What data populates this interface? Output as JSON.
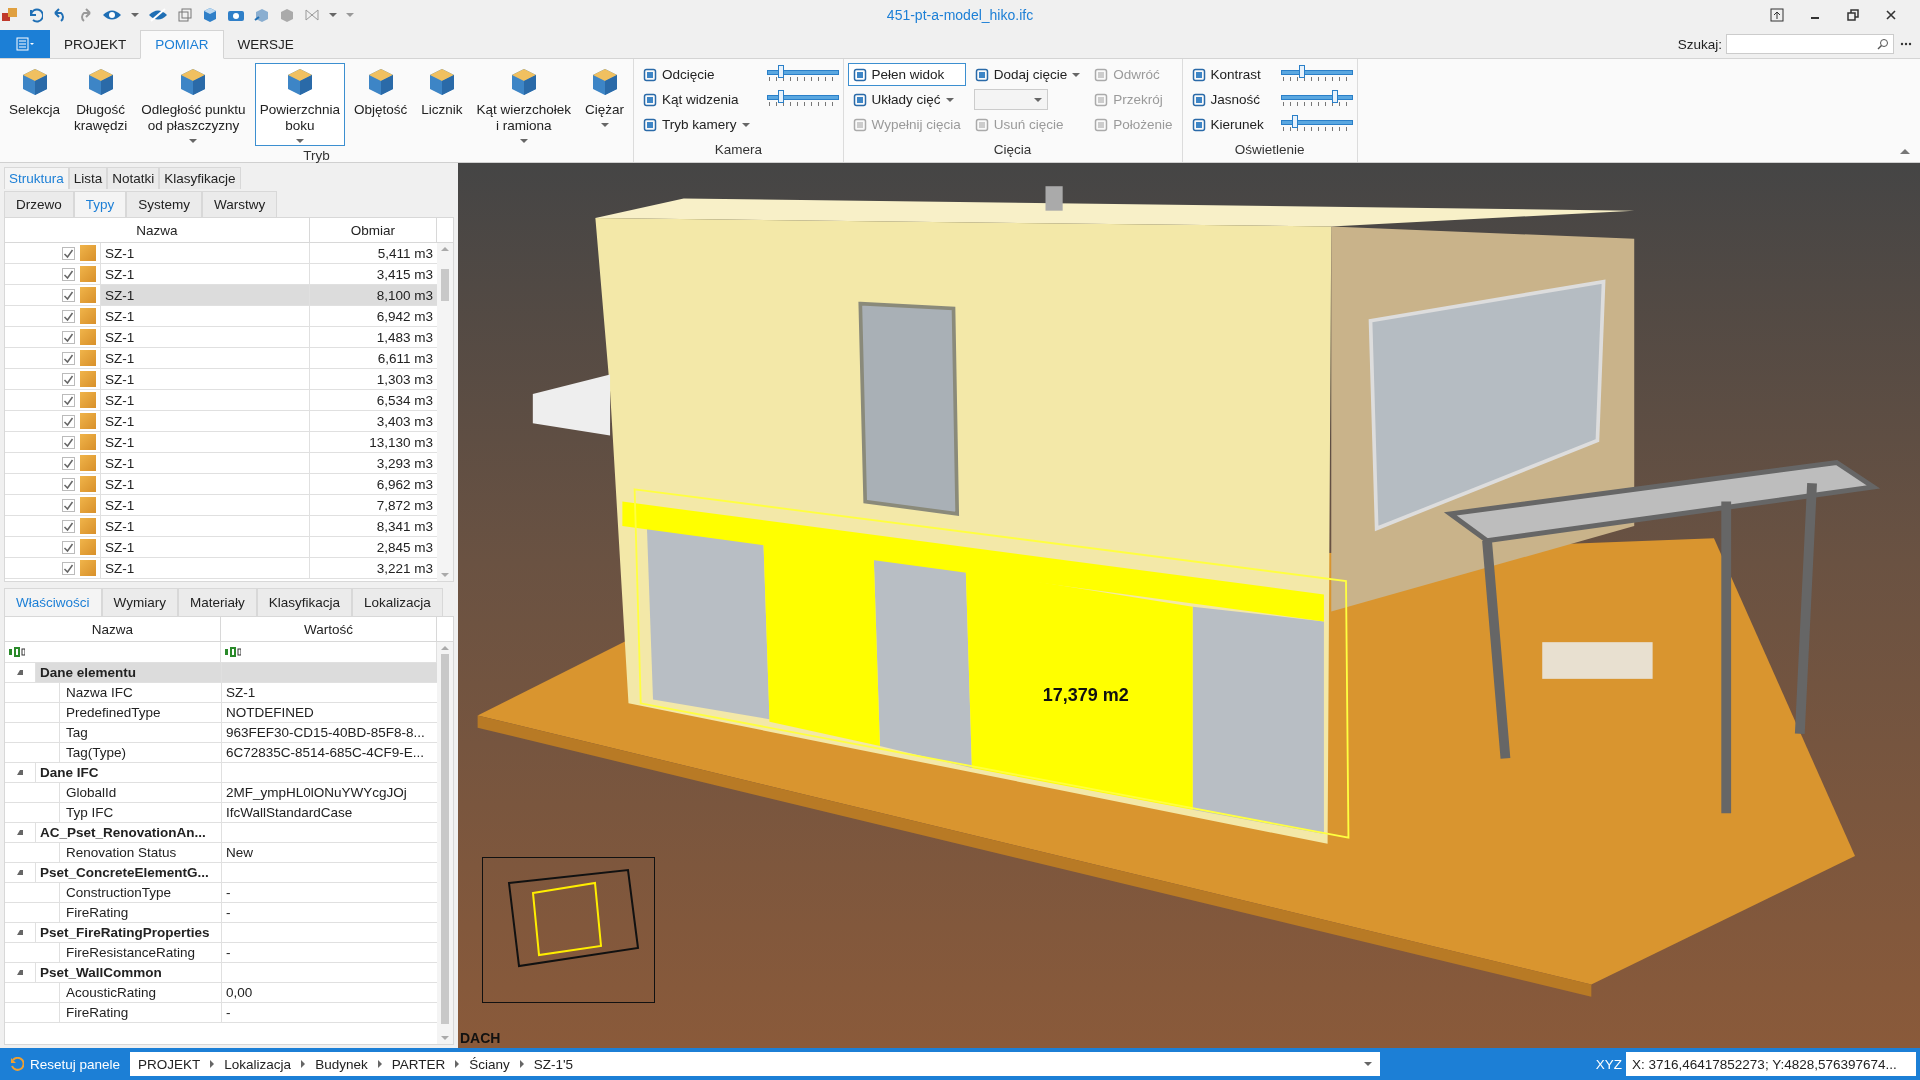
{
  "window": {
    "title": "451-pt-a-model_hiko.ifc"
  },
  "ribbon_tabs": [
    {
      "label": "PROJEKT",
      "selected": false
    },
    {
      "label": "POMIAR",
      "selected": true
    },
    {
      "label": "WERSJE",
      "selected": false
    }
  ],
  "search": {
    "label": "Szukaj:"
  },
  "ribbon_groups": [
    {
      "title": "Tryb",
      "columns": [
        [
          {
            "kind": "large",
            "lines": [
              "Selekcja"
            ],
            "dropdown": false,
            "selected": false
          }
        ],
        [
          {
            "kind": "large",
            "lines": [
              "Długość",
              "krawędzi"
            ],
            "dropdown": false,
            "selected": false
          }
        ],
        [
          {
            "kind": "large",
            "lines": [
              "Odległość punktu",
              "od płaszczyzny"
            ],
            "dropdown": true,
            "selected": false
          }
        ],
        [
          {
            "kind": "large",
            "lines": [
              "Powierzchnia",
              "boku"
            ],
            "dropdown": true,
            "selected": true
          }
        ],
        [
          {
            "kind": "large",
            "lines": [
              "Objętość"
            ],
            "dropdown": false,
            "selected": false
          }
        ],
        [
          {
            "kind": "large",
            "lines": [
              "Licznik"
            ],
            "dropdown": false,
            "selected": false
          }
        ],
        [
          {
            "kind": "large",
            "lines": [
              "Kąt wierzchołek",
              "i ramiona"
            ],
            "dropdown": true,
            "selected": false
          }
        ],
        [
          {
            "kind": "large",
            "lines": [
              "Ciężar"
            ],
            "dropdown": true,
            "selected": false
          }
        ]
      ]
    },
    {
      "title": "Kamera",
      "columns": [
        [
          {
            "kind": "small",
            "label": "Odcięcie",
            "dropdown": false,
            "disabled": false,
            "pressed": false
          },
          {
            "kind": "small",
            "label": "Kąt widzenia",
            "dropdown": false,
            "disabled": false,
            "pressed": false
          },
          {
            "kind": "small",
            "label": "Tryb kamery",
            "dropdown": true,
            "disabled": false,
            "pressed": false
          }
        ],
        [
          {
            "kind": "slider",
            "level": 0.2
          },
          {
            "kind": "slider",
            "level": 0.2
          }
        ]
      ]
    },
    {
      "title": "Cięcia",
      "columns": [
        [
          {
            "kind": "small",
            "label": "Pełen widok",
            "dropdown": false,
            "disabled": false,
            "pressed": true
          },
          {
            "kind": "small",
            "label": "Układy cięć",
            "dropdown": true,
            "disabled": false,
            "pressed": false
          },
          {
            "kind": "small",
            "label": "Wypełnij cięcia",
            "dropdown": false,
            "disabled": true,
            "pressed": false
          }
        ],
        [
          {
            "kind": "small",
            "label": "Dodaj cięcie",
            "dropdown": true,
            "disabled": false,
            "pressed": false
          },
          {
            "kind": "combo"
          },
          {
            "kind": "small",
            "label": "Usuń cięcie",
            "dropdown": false,
            "disabled": true,
            "pressed": false
          }
        ],
        [
          {
            "kind": "small",
            "label": "Odwróć",
            "dropdown": false,
            "disabled": true,
            "pressed": false
          },
          {
            "kind": "small",
            "label": "Przekrój",
            "dropdown": false,
            "disabled": true,
            "pressed": false
          },
          {
            "kind": "small",
            "label": "Położenie",
            "dropdown": false,
            "disabled": true,
            "pressed": false
          }
        ]
      ]
    },
    {
      "title": "Oświetlenie",
      "columns": [
        [
          {
            "kind": "small",
            "label": "Kontrast",
            "dropdown": false,
            "disabled": false,
            "pressed": false
          },
          {
            "kind": "small",
            "label": "Jasność",
            "dropdown": false,
            "disabled": false,
            "pressed": false
          },
          {
            "kind": "small",
            "label": "Kierunek",
            "dropdown": false,
            "disabled": false,
            "pressed": false
          }
        ],
        [
          {
            "kind": "slider",
            "level": 0.3
          },
          {
            "kind": "slider",
            "level": 0.75
          },
          {
            "kind": "slider",
            "level": 0.2
          }
        ]
      ]
    }
  ],
  "structure_panel": {
    "tabs": [
      {
        "label": "Struktura",
        "selected": true
      },
      {
        "label": "Lista",
        "selected": false
      },
      {
        "label": "Notatki",
        "selected": false
      },
      {
        "label": "Klasyfikacje",
        "selected": false
      }
    ],
    "subtabs": [
      {
        "label": "Drzewo",
        "selected": false
      },
      {
        "label": "Typy",
        "selected": true
      },
      {
        "label": "Systemy",
        "selected": false
      },
      {
        "label": "Warstwy",
        "selected": false
      }
    ],
    "columns": [
      "Nazwa",
      "Obmiar"
    ],
    "rows": [
      {
        "name": "SZ-1",
        "value": "5,411 m3",
        "checked": true,
        "selected": false
      },
      {
        "name": "SZ-1",
        "value": "3,415 m3",
        "checked": true,
        "selected": false
      },
      {
        "name": "SZ-1",
        "value": "8,100 m3",
        "checked": true,
        "selected": true
      },
      {
        "name": "SZ-1",
        "value": "6,942 m3",
        "checked": true,
        "selected": false
      },
      {
        "name": "SZ-1",
        "value": "1,483 m3",
        "checked": true,
        "selected": false
      },
      {
        "name": "SZ-1",
        "value": "6,611 m3",
        "checked": true,
        "selected": false
      },
      {
        "name": "SZ-1",
        "value": "1,303 m3",
        "checked": true,
        "selected": false
      },
      {
        "name": "SZ-1",
        "value": "6,534 m3",
        "checked": true,
        "selected": false
      },
      {
        "name": "SZ-1",
        "value": "3,403 m3",
        "checked": true,
        "selected": false
      },
      {
        "name": "SZ-1",
        "value": "13,130 m3",
        "checked": true,
        "selected": false
      },
      {
        "name": "SZ-1",
        "value": "3,293 m3",
        "checked": true,
        "selected": false
      },
      {
        "name": "SZ-1",
        "value": "6,962 m3",
        "checked": true,
        "selected": false
      },
      {
        "name": "SZ-1",
        "value": "7,872 m3",
        "checked": true,
        "selected": false
      },
      {
        "name": "SZ-1",
        "value": "8,341 m3",
        "checked": true,
        "selected": false
      },
      {
        "name": "SZ-1",
        "value": "2,845 m3",
        "checked": true,
        "selected": false
      },
      {
        "name": "SZ-1",
        "value": "3,221 m3",
        "checked": true,
        "selected": false
      }
    ]
  },
  "properties_panel": {
    "tabs": [
      {
        "label": "Właściwości",
        "selected": true
      },
      {
        "label": "Wymiary",
        "selected": false
      },
      {
        "label": "Materiały",
        "selected": false
      },
      {
        "label": "Klasyfikacja",
        "selected": false
      },
      {
        "label": "Lokalizacja",
        "selected": false
      }
    ],
    "columns": [
      "Nazwa",
      "Wartość"
    ],
    "groups": [
      {
        "name": "Dane elementu",
        "expanded": true,
        "selected": true,
        "children": [
          {
            "name": "Nazwa IFC",
            "value": "SZ-1"
          },
          {
            "name": "PredefinedType",
            "value": "NOTDEFINED"
          },
          {
            "name": "Tag",
            "value": "963FEF30-CD15-40BD-85F8-8..."
          },
          {
            "name": "Tag(Type)",
            "value": "6C72835C-8514-685C-4CF9-E..."
          }
        ]
      },
      {
        "name": "Dane IFC",
        "expanded": true,
        "selected": false,
        "children": [
          {
            "name": "GlobalId",
            "value": "2MF_ympHL0lONuYWYcgJOj"
          },
          {
            "name": "Typ IFC",
            "value": "IfcWallStandardCase"
          }
        ]
      },
      {
        "name": "AC_Pset_RenovationAn...",
        "expanded": true,
        "selected": false,
        "children": [
          {
            "name": "Renovation Status",
            "value": "New"
          }
        ]
      },
      {
        "name": "Pset_ConcreteElementG...",
        "expanded": true,
        "selected": false,
        "children": [
          {
            "name": "ConstructionType",
            "value": "-"
          },
          {
            "name": "FireRating",
            "value": "-"
          }
        ]
      },
      {
        "name": "Pset_FireRatingProperties",
        "expanded": true,
        "selected": false,
        "children": [
          {
            "name": "FireResistanceRating",
            "value": "-"
          }
        ]
      },
      {
        "name": "Pset_WallCommon",
        "expanded": true,
        "selected": false,
        "children": [
          {
            "name": "AcousticRating",
            "value": "0,00"
          },
          {
            "name": "FireRating",
            "value": "-"
          }
        ]
      }
    ]
  },
  "viewport": {
    "measurement": "17,379 m2",
    "floor_label": "DACH"
  },
  "status_bar": {
    "reset_button": "Resetuj panele",
    "breadcrumb": [
      "PROJEKT",
      "Lokalizacja",
      "Budynek",
      "PARTER",
      "Ściany",
      "SZ-1'5"
    ],
    "coords_label": "XYZ",
    "coords": "X: 3716,46417852273; Y:4828,576397674..."
  }
}
